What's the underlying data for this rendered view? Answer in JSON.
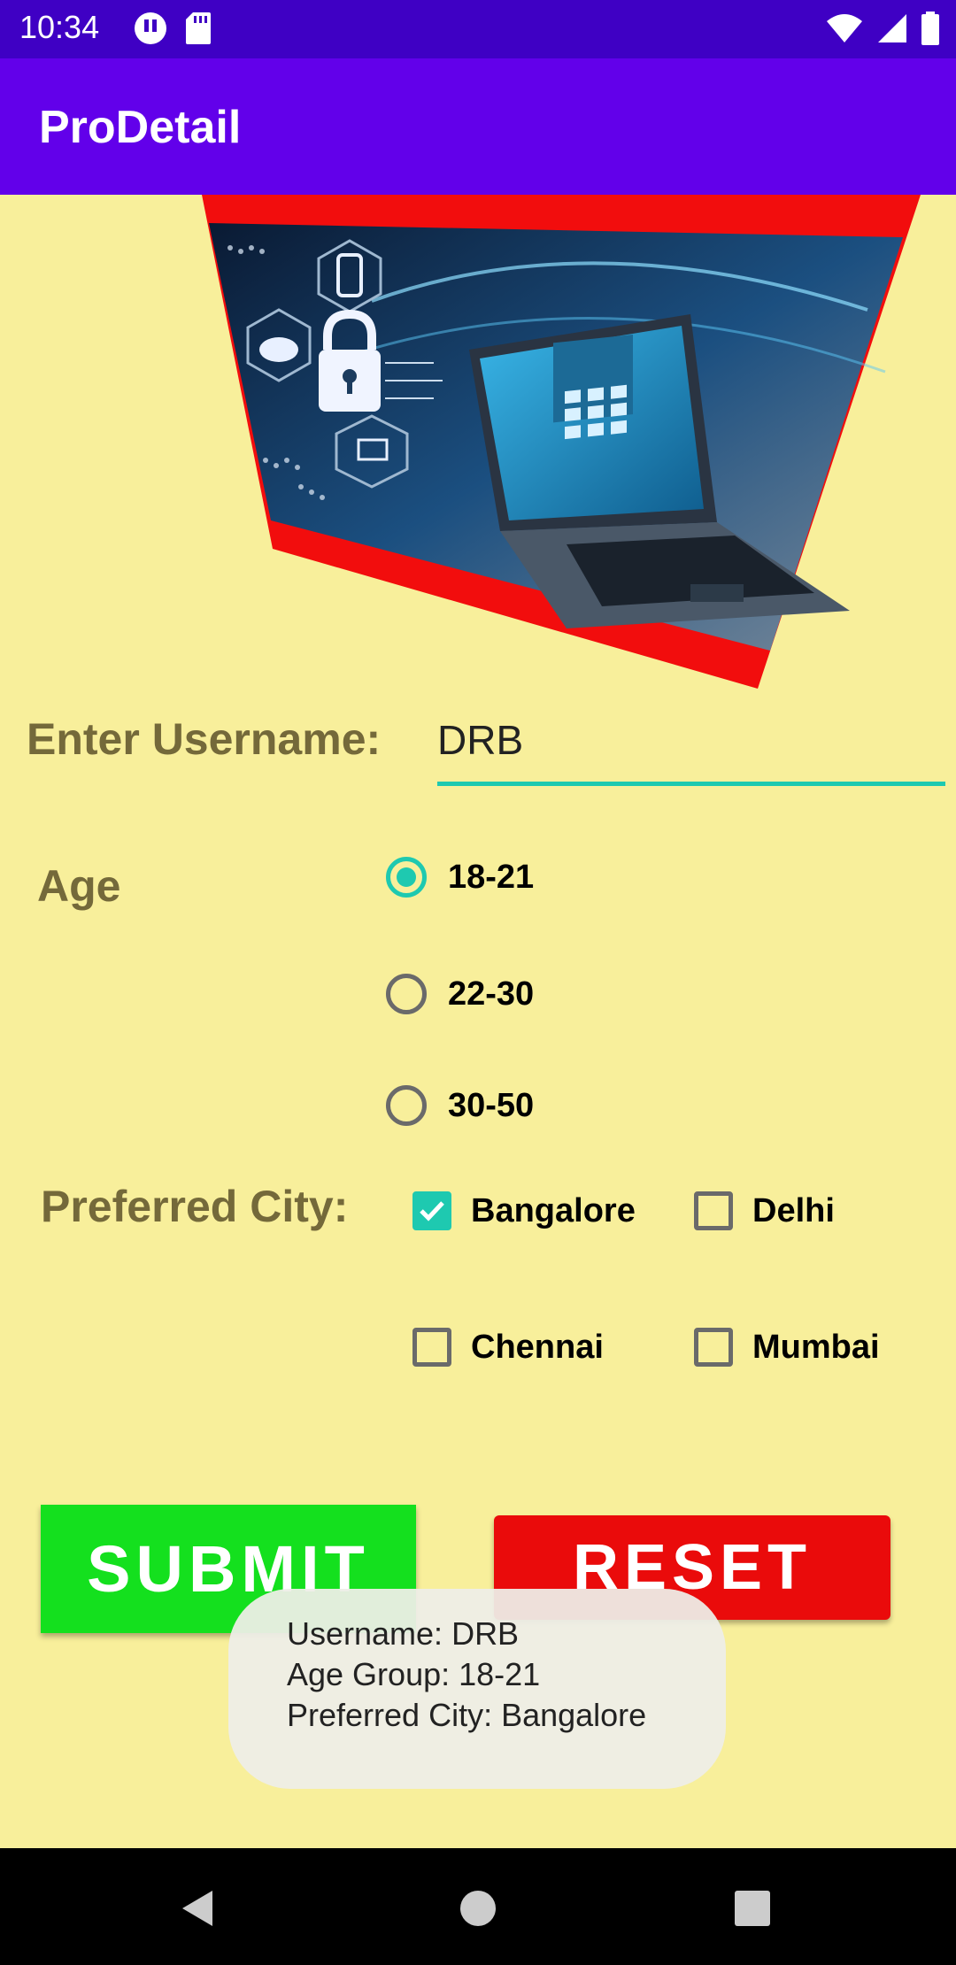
{
  "status_bar": {
    "time": "10:34"
  },
  "app_bar": {
    "title": "ProDetail"
  },
  "form": {
    "username_label": "Enter Username:",
    "username_value": "DRB",
    "age_label": "Age",
    "age_options": [
      {
        "label": "18-21",
        "checked": true
      },
      {
        "label": "22-30",
        "checked": false
      },
      {
        "label": "30-50",
        "checked": false
      }
    ],
    "city_label": "Preferred City:",
    "city_options": [
      {
        "label": "Bangalore",
        "checked": true
      },
      {
        "label": "Delhi",
        "checked": false
      },
      {
        "label": "Chennai",
        "checked": false
      },
      {
        "label": "Mumbai",
        "checked": false
      }
    ]
  },
  "buttons": {
    "submit": "SUBMIT",
    "reset": "RESET"
  },
  "toast": {
    "line1": "Username: DRB",
    "line2": "Age Group: 18-21",
    "line3": "Preferred City: Bangalore"
  },
  "colors": {
    "background": "#f8ef9b",
    "status_bar": "#3f00c4",
    "app_bar": "#6200ea",
    "accent": "#1ec9b0",
    "submit": "#14e01e",
    "reset": "#ea0b0b"
  }
}
